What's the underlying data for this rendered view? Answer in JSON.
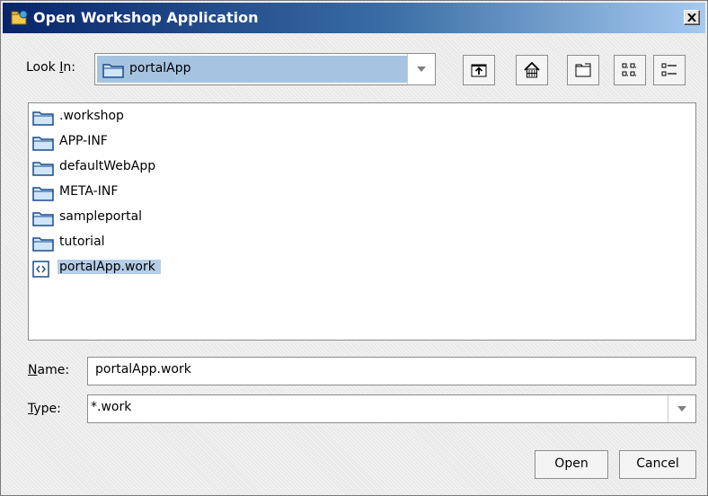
{
  "window": {
    "title": "Open Workshop Application"
  },
  "lookin": {
    "label_prefix": "Look ",
    "label_key": "I",
    "label_suffix": "n:",
    "value": "portalApp"
  },
  "toolbar": [
    {
      "name": "up-one-level-button",
      "icon": "folder-up-icon"
    },
    {
      "name": "home-button",
      "icon": "home-icon"
    },
    {
      "name": "create-new-folder-button",
      "icon": "new-folder-icon"
    },
    {
      "name": "list-view-button",
      "icon": "list-view-icon"
    },
    {
      "name": "details-view-button",
      "icon": "details-view-icon"
    }
  ],
  "files": [
    {
      "name": ".workshop",
      "type": "folder"
    },
    {
      "name": "APP-INF",
      "type": "folder"
    },
    {
      "name": "defaultWebApp",
      "type": "folder"
    },
    {
      "name": "META-INF",
      "type": "folder"
    },
    {
      "name": "sampleportal",
      "type": "folder"
    },
    {
      "name": "tutorial",
      "type": "folder"
    },
    {
      "name": "portalApp.work",
      "type": "file",
      "selected": true
    }
  ],
  "name_field": {
    "label_key": "N",
    "label_suffix": "ame:",
    "value": "portalApp.work"
  },
  "type_field": {
    "label_key": "T",
    "label_suffix": "ype:",
    "value": "*.work"
  },
  "buttons": {
    "open": "Open",
    "cancel": "Cancel"
  },
  "colors": {
    "title_start": "#08246b",
    "title_end": "#a6caf0",
    "selection": "#b5cde6",
    "combo_selection": "#a6c4e2"
  }
}
